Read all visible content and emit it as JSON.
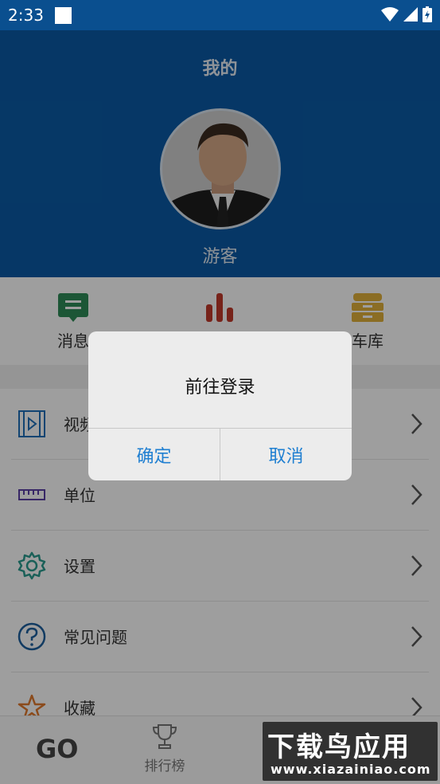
{
  "status_bar": {
    "time": "2:33"
  },
  "header": {
    "title": "我的",
    "username": "游客"
  },
  "quick_actions": [
    {
      "label": "消息",
      "icon": "message-icon",
      "color": "#2e8b57"
    },
    {
      "label": "",
      "icon": "chart-bars-icon",
      "color": "#c0392b"
    },
    {
      "label": "车库",
      "icon": "garage-icon",
      "color": "#e0b13a"
    }
  ],
  "menu": [
    {
      "label": "视频",
      "icon": "video-icon",
      "color": "#1e6fb8"
    },
    {
      "label": "单位",
      "icon": "ruler-icon",
      "color": "#5b3fa5"
    },
    {
      "label": "设置",
      "icon": "gear-icon",
      "color": "#2a9b8f"
    },
    {
      "label": "常见问题",
      "icon": "question-icon",
      "color": "#1e5f9e"
    },
    {
      "label": "收藏",
      "icon": "star-icon",
      "color": "#e07a2e"
    }
  ],
  "bottom_nav": {
    "go_label": "GO",
    "tabs": [
      {
        "label": "排行榜",
        "icon": "trophy-icon"
      }
    ]
  },
  "dialog": {
    "message": "前往登录",
    "confirm": "确定",
    "cancel": "取消"
  },
  "watermark": {
    "text": "下载鸟应用",
    "url": "www.xiazainiao.com"
  }
}
